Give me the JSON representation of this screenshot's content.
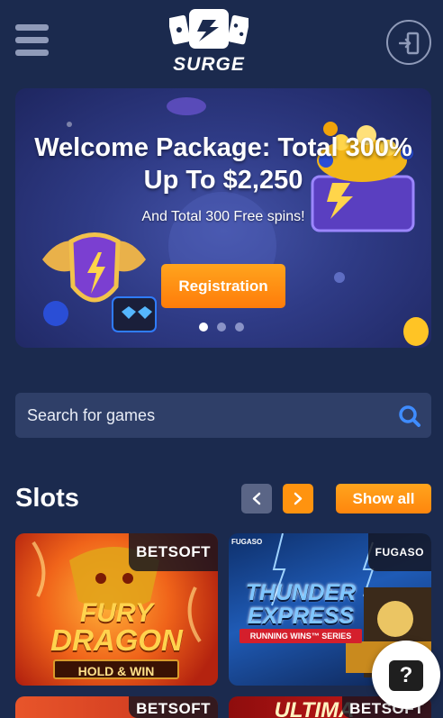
{
  "header": {
    "menu_icon": "hamburger-icon",
    "logo_text": "SURGE",
    "login_icon": "login-icon"
  },
  "banner": {
    "title_line1": "Welcome Package: Total 300%",
    "title_line2": "Up To $2,250",
    "subtitle": "And Total 300 Free spins!",
    "button_label": "Registration",
    "slides_total": 3,
    "active_slide": 1
  },
  "search": {
    "placeholder": "Search for games",
    "icon": "search-icon"
  },
  "slots": {
    "title": "Slots",
    "show_all_label": "Show all",
    "prev_icon": "chevron-left-icon",
    "next_icon": "chevron-right-icon",
    "games": [
      {
        "line1": "FURY",
        "line2": "DRAGON",
        "tag": "HOLD & WIN",
        "provider": "BETSOFT"
      },
      {
        "line1": "THUNDER",
        "line2": "EXPRESS",
        "tag": "RUNNING WINS™ SERIES",
        "provider": "FUGASO",
        "provider_small": "FUGASO"
      },
      {
        "line1": "",
        "line2": "",
        "tag": "",
        "provider": "BETSOFT"
      },
      {
        "line1": "ULTIMA",
        "line2": "",
        "tag": "",
        "provider": "BETSOFT"
      }
    ]
  },
  "help": {
    "label": "?"
  },
  "colors": {
    "background": "#1b2a4e",
    "accent": "#ff930f",
    "search_bg": "#2f3f68",
    "muted_icon": "#8f9ab8"
  }
}
